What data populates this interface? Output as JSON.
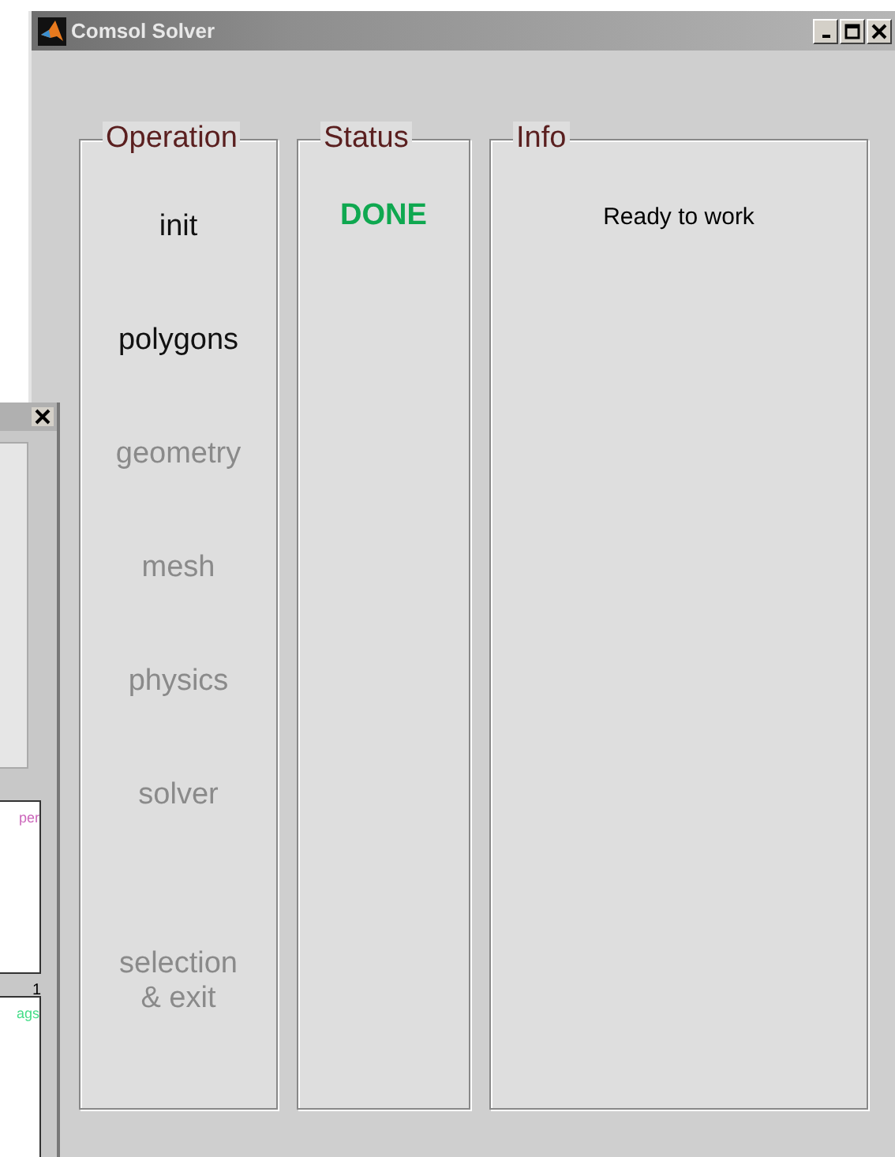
{
  "window": {
    "title": "Comsol Solver"
  },
  "panels": {
    "operation": {
      "title": "Operation",
      "items": [
        {
          "label": "init",
          "disabled": false
        },
        {
          "label": "polygons",
          "disabled": false
        },
        {
          "label": "geometry",
          "disabled": true
        },
        {
          "label": "mesh",
          "disabled": true
        },
        {
          "label": "physics",
          "disabled": true
        },
        {
          "label": "solver",
          "disabled": true
        },
        {
          "label": "selection\n& exit",
          "disabled": true
        }
      ]
    },
    "status": {
      "title": "Status",
      "items": [
        {
          "label": "DONE",
          "color": "#0fa850"
        }
      ]
    },
    "info": {
      "title": "Info",
      "text": "Ready to work"
    }
  },
  "background_window": {
    "plots": [
      {
        "legend": "per",
        "color": "#cc66bb"
      },
      {
        "legend": "ags",
        "color": "#44dd88"
      }
    ],
    "axis_label": "1"
  }
}
